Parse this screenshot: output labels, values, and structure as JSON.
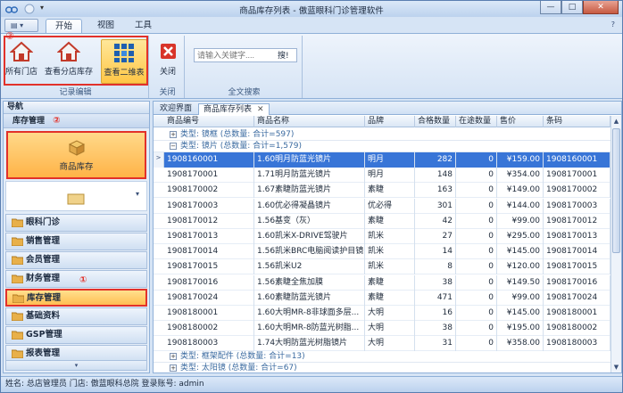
{
  "window": {
    "title": "商品库存列表 - 傲蓝眼科门诊管理软件",
    "min": "—",
    "max": "□",
    "close": "✕"
  },
  "ribbon": {
    "tabs": [
      "开始",
      "视图",
      "工具"
    ],
    "help": "?",
    "groups": {
      "record_browse": {
        "label": "记录编辑",
        "buttons": [
          "所有门店",
          "查看分店库存",
          "查看二维表"
        ]
      },
      "close": {
        "label": "关闭",
        "button": "关闭"
      },
      "search": {
        "label": "全文搜索",
        "placeholder": "请输入关键字....",
        "go": "搜!"
      }
    },
    "marker": "③"
  },
  "nav": {
    "header": "导航",
    "section": "库存管理",
    "section_marker": "②",
    "big_item": "商品库存",
    "items": [
      "眼科门诊",
      "销售管理",
      "会员管理",
      "财务管理",
      "库存管理",
      "基础资料",
      "GSP管理",
      "报表管理"
    ],
    "item_marker": "①"
  },
  "doc_tabs": [
    "欢迎界面",
    "商品库存列表"
  ],
  "table": {
    "columns": [
      "商品编号",
      "商品名称",
      "品牌",
      "合格数量",
      "在途数量",
      "售价",
      "条码"
    ],
    "groups": [
      "类型: 镜框 (总数量: 合计=597)",
      "类型: 镜片 (总数量: 合计=1,579)",
      "类型: 框架配件 (总数量: 合计=13)",
      "类型: 太阳镜 (总数量: 合计=67)"
    ],
    "rows": [
      [
        "1908160001",
        "1.60明月防蓝光镜片",
        "明月",
        "282",
        "0",
        "¥159.00",
        "1908160001"
      ],
      [
        "1908170001",
        "1.71明月防蓝光镜片",
        "明月",
        "148",
        "0",
        "¥354.00",
        "1908170001"
      ],
      [
        "1908170002",
        "1.67素睫防蓝光镜片",
        "素睫",
        "163",
        "0",
        "¥149.00",
        "1908170002"
      ],
      [
        "1908170003",
        "1.60优必得凝晶镜片",
        "优必得",
        "301",
        "0",
        "¥144.00",
        "1908170003"
      ],
      [
        "1908170012",
        "1.56基变（灰）",
        "素睫",
        "42",
        "0",
        "¥99.00",
        "1908170012"
      ],
      [
        "1908170013",
        "1.60凯米X-DRIVE驾驶片",
        "凯米",
        "27",
        "0",
        "¥295.00",
        "1908170013"
      ],
      [
        "1908170014",
        "1.56凯米BRC电脑阅读护目镜",
        "凯米",
        "14",
        "0",
        "¥145.00",
        "1908170014"
      ],
      [
        "1908170015",
        "1.56凯米U2",
        "凯米",
        "8",
        "0",
        "¥120.00",
        "1908170015"
      ],
      [
        "1908170016",
        "1.56素睫全焦加膜",
        "素睫",
        "38",
        "0",
        "¥149.50",
        "1908170016"
      ],
      [
        "1908170024",
        "1.60素睫防蓝光镜片",
        "素睫",
        "471",
        "0",
        "¥99.00",
        "1908170024"
      ],
      [
        "1908180001",
        "1.60大明MR-8非球面多层...",
        "大明",
        "16",
        "0",
        "¥145.00",
        "1908180001"
      ],
      [
        "1908180002",
        "1.60大明MR-8防蓝光树脂...",
        "大明",
        "38",
        "0",
        "¥195.00",
        "1908180002"
      ],
      [
        "1908180003",
        "1.74大明防蓝光树脂镜片",
        "大明",
        "31",
        "0",
        "¥358.00",
        "1908180003"
      ]
    ]
  },
  "status": "姓名: 总店管理员  门店: 傲蓝眼科总院  登录账号: admin"
}
